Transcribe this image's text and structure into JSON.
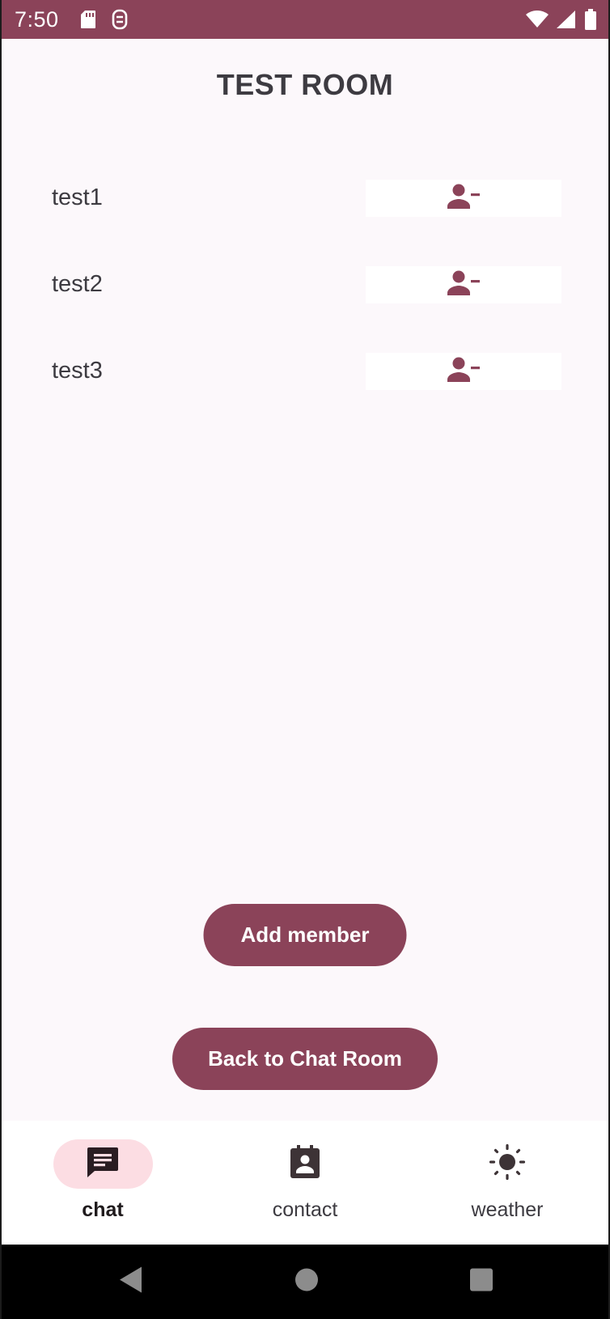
{
  "status_bar": {
    "time": "7:50",
    "icons": [
      "sd-card-icon",
      "vpn-key-icon",
      "wifi-icon",
      "cell-signal-icon",
      "battery-icon"
    ]
  },
  "page": {
    "title": "TEST ROOM"
  },
  "members": [
    {
      "name": "test1",
      "action_icon": "person-remove-icon"
    },
    {
      "name": "test2",
      "action_icon": "person-remove-icon"
    },
    {
      "name": "test3",
      "action_icon": "person-remove-icon"
    }
  ],
  "actions": {
    "add_member_label": "Add member",
    "back_label": "Back to Chat Room"
  },
  "bottom_nav": {
    "items": [
      {
        "label": "chat",
        "icon": "chat-icon",
        "active": true
      },
      {
        "label": "contact",
        "icon": "contact-icon",
        "active": false
      },
      {
        "label": "weather",
        "icon": "sun-icon",
        "active": false
      }
    ]
  },
  "theme": {
    "primary": "#8b4359",
    "nav_indicator": "#fcdde3",
    "background": "#fcf8fb",
    "text": "#3d3b41"
  }
}
